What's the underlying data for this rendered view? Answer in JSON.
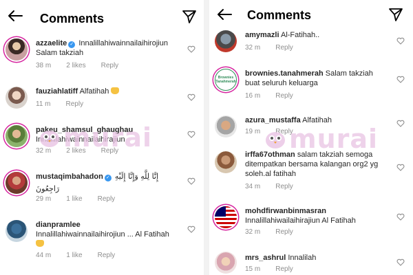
{
  "left_panel": {
    "title": "Comments",
    "comments": [
      {
        "username": "azzaelite",
        "verified": true,
        "text": "Innalillahiwainnailaihirojiun",
        "text2": "Salam takziah",
        "time": "38 m",
        "likes": "2 likes",
        "reply": "Reply"
      },
      {
        "username": "fauziahlatiff",
        "text": "Alfatihah",
        "time": "11 m",
        "reply": "Reply"
      },
      {
        "username": "pakeu_shamsul_ghaughau",
        "text": "Innalillahiwainnailaihirajiun",
        "time": "32 m",
        "likes": "2 likes",
        "reply": "Reply"
      },
      {
        "username": "mustaqimbahadon",
        "verified": true,
        "text": "إِنَّا لِلَّهِ وَإِنَّا إِلَيْهِ",
        "text2": "رَاجِعُونَ",
        "time": "29 m",
        "likes": "1 like",
        "reply": "Reply"
      },
      {
        "username": "dianpramlee",
        "text": "Innalillahiwainnailaihirojiun ... Al Fatihah",
        "time": "44 m",
        "likes": "1 like",
        "reply": "Reply"
      }
    ]
  },
  "right_panel": {
    "title": "Comments",
    "comments": [
      {
        "username": "amymazli",
        "text": "Al-Fatihah..",
        "time": "32 m",
        "reply": "Reply"
      },
      {
        "username": "brownies.tanahmerah",
        "avatar_text": "Brownies Tanahmerah",
        "text": "Salam takziah",
        "text2": "buat seluruh keluarga",
        "time": "16 m",
        "reply": "Reply"
      },
      {
        "username": "azura_mustaffa",
        "text": "Alfatihah",
        "time": "19 m",
        "reply": "Reply"
      },
      {
        "username": "irffa67othman",
        "text": "salam takziah semoga",
        "text2": "ditempatkan bersama kalangan org2 yg",
        "text3": "soleh.al fatihah",
        "time": "34 m",
        "reply": "Reply"
      },
      {
        "username": "mohdfirwanbinmasran",
        "text": "Innalillahiwailaihirajiun Al Fatihah",
        "time": "32 m",
        "reply": "Reply"
      },
      {
        "username": "mrs_ashrul",
        "text": "Innalilah",
        "time": "15 m",
        "reply": "Reply"
      }
    ]
  },
  "watermark": {
    "text": "murai"
  },
  "icons": {
    "back": "arrow-left-icon",
    "send": "paper-plane-icon",
    "like": "heart-outline-icon",
    "verified": "verified-badge-icon",
    "prayer": "praying-hands-emoji"
  },
  "colors": {
    "verified": "#3897f0",
    "meta_text": "#8e8e8e",
    "story_ring": "#d6249f",
    "watermark": "#e9c3e3"
  }
}
